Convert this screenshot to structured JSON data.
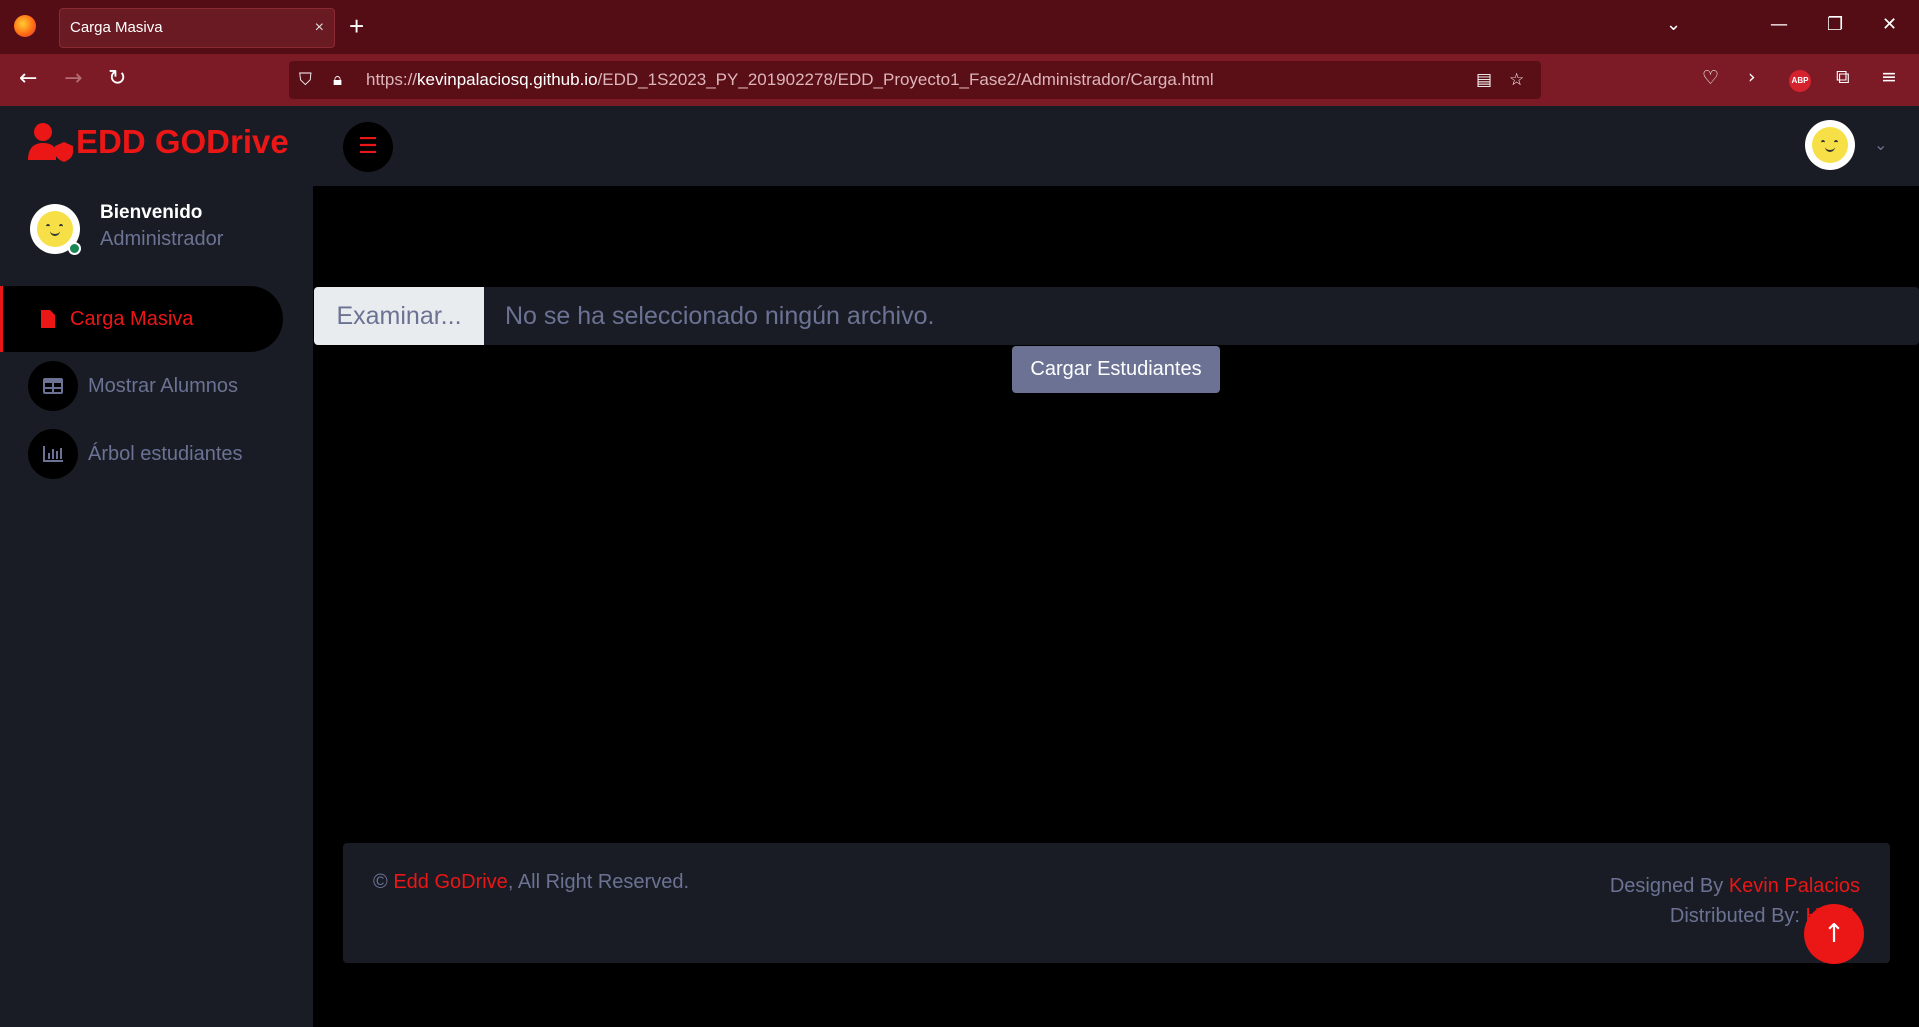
{
  "browser": {
    "tab_title": "Carga Masiva",
    "tab_close": "×",
    "new_tab": "+",
    "url_prefix": "https://",
    "url_host": "kevinpalaciosq.github.io",
    "url_path": "/EDD_1S2023_PY_201902278/EDD_Proyecto1_Fase2/Administrador/Carga.html",
    "abp_label": "ABP"
  },
  "app": {
    "brand": "EDD GODrive",
    "accent": "#eb1616"
  },
  "sidebar": {
    "welcome": "Bienvenido",
    "role": "Administrador",
    "items": [
      {
        "label": "Carga Masiva",
        "icon": "file-icon",
        "active": true
      },
      {
        "label": "Mostrar Alumnos",
        "icon": "table-icon",
        "active": false
      },
      {
        "label": "Árbol estudiantes",
        "icon": "chart-bar-icon",
        "active": false
      }
    ]
  },
  "main": {
    "browse_label": "Examinar...",
    "no_file_text": "No se ha seleccionado ningún archivo.",
    "upload_button": "Cargar Estudiantes"
  },
  "footer": {
    "copyright_symbol": "©",
    "brand_link": "Edd GoDrive",
    "rights": ", All Right Reserved.",
    "designed_by_label": "Designed By ",
    "designer_link": "Kevin Palacios",
    "distributed_by_label": "Distributed By:",
    "distributor_link": "HTML"
  }
}
